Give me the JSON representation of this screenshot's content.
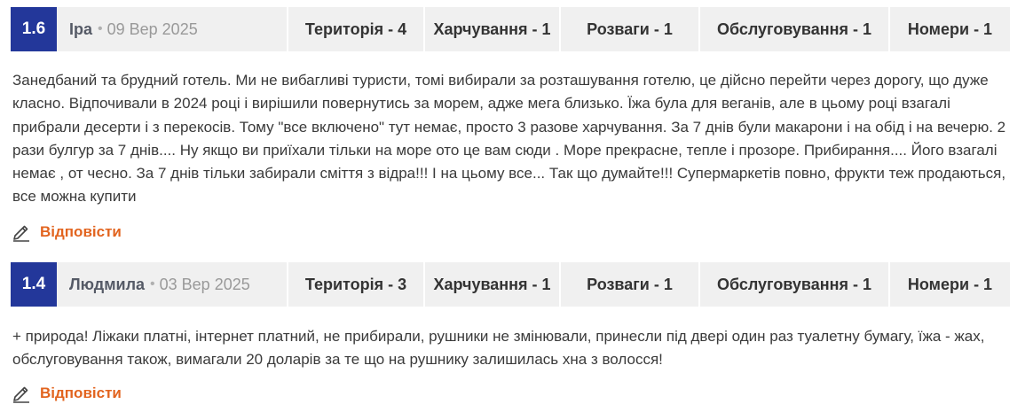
{
  "reviews": [
    {
      "score": "1.6",
      "author": "Іра",
      "date": "09 Вер 2025",
      "ratings": [
        {
          "label": "Територія - 4"
        },
        {
          "label": "Харчування - 1"
        },
        {
          "label": "Розваги - 1"
        },
        {
          "label": "Обслуговування - 1"
        },
        {
          "label": "Номери - 1"
        }
      ],
      "text": "Занедбаний та брудний готель. Ми не вибагливі туристи, томі вибирали за розташування готелю, це дійсно перейти через дорогу, що дуже класно. Відпочивали в 2024 році і вирішили повернутись за морем, адже мега близько. Їжа була для веганів, але в цьому році взагалі прибрали десерти і з перекосів. Тому \"все включено\" тут немає, просто 3 разове харчування. За 7 днів були макарони і на обід і на вечерю. 2 рази булгур за 7 днів.... Ну якщо ви приїхали тільки на море ото це вам сюди . Море прекрасне, тепле і прозоре. Прибирання.... Його взагалі немає , от чесно. За 7 днів тільки забирали сміття з відра!!! І на цьому все... Так що думайте!!! Супермаркетів повно, фрукти теж продаються, все можна купити",
      "reply_label": "Відповісти"
    },
    {
      "score": "1.4",
      "author": "Людмила",
      "date": "03 Вер 2025",
      "ratings": [
        {
          "label": "Територія - 3"
        },
        {
          "label": "Харчування - 1"
        },
        {
          "label": "Розваги - 1"
        },
        {
          "label": "Обслуговування - 1"
        },
        {
          "label": "Номери - 1"
        }
      ],
      "text": "+ природа! Ліжаки платні, інтернет платний, не прибирали, рушники не змінювали, принесли під двері один раз туалетну бумагу, їжа - жах, обслуговування також, вимагали 20 доларів за те що на рушнику залишилась хна з волосся!",
      "reply_label": "Відповісти"
    }
  ],
  "colors": {
    "score_bg": "#23379a",
    "header_bg": "#f0f0f0",
    "reply": "#e2641f"
  },
  "icons": {
    "reply": "pencil-icon"
  }
}
